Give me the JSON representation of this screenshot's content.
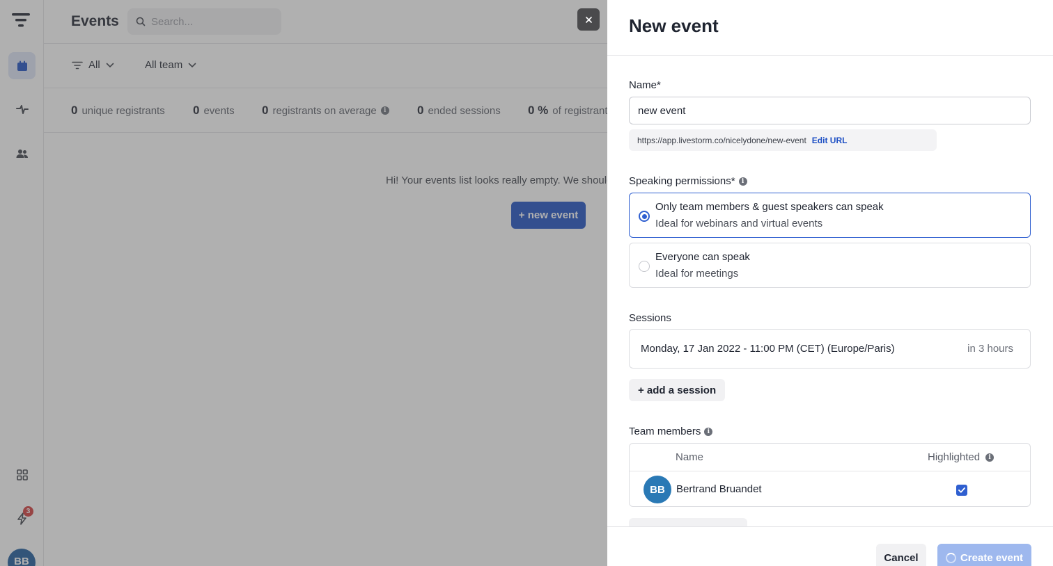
{
  "colors": {
    "accent": "#1d4fc4",
    "selected_border": "#2f5fd0",
    "badge": "#d23b3b",
    "overlay": "#505050"
  },
  "sidebar": {
    "items": [
      {
        "name": "calendar-icon",
        "active": true
      },
      {
        "name": "activity-icon",
        "active": false
      },
      {
        "name": "people-icon",
        "active": false
      },
      {
        "name": "apps-grid-icon",
        "active": false
      },
      {
        "name": "lightning-icon",
        "active": false
      }
    ],
    "notification_count": "3",
    "user_initials": "BB"
  },
  "header": {
    "title": "Events",
    "search_placeholder": "Search..."
  },
  "filters": {
    "status": "All",
    "team": "All team"
  },
  "stats": [
    {
      "value": "0",
      "label": "unique registrants"
    },
    {
      "value": "0",
      "label": "events"
    },
    {
      "value": "0",
      "label": "registrants on average"
    },
    {
      "value": "0",
      "label": "ended sessions"
    },
    {
      "value": "0 %",
      "label": "of registrant"
    }
  ],
  "empty_state": {
    "message": "Hi! Your events list looks really empty. We should",
    "button": "+ new event"
  },
  "drawer": {
    "title": "New event",
    "name_label": "Name*",
    "name_value": "new event",
    "url": "https://app.livestorm.co/nicelydone/new-event",
    "edit_url": "Edit URL",
    "permissions_label": "Speaking permissions*",
    "permissions": [
      {
        "title": "Only team members & guest speakers can speak",
        "subtitle": "Ideal for webinars and virtual events",
        "selected": true
      },
      {
        "title": "Everyone can speak",
        "subtitle": "Ideal for meetings",
        "selected": false
      }
    ],
    "sessions_label": "Sessions",
    "session": {
      "datetime": "Monday, 17 Jan 2022 - 11:00 PM (CET) (Europe/Paris)",
      "relative": "in 3 hours"
    },
    "add_session": "+ add a session",
    "team_label": "Team members",
    "team_columns": {
      "name": "Name",
      "highlighted": "Highlighted"
    },
    "members": [
      {
        "initials": "BB",
        "name": "Bertrand Bruandet",
        "highlighted": true
      }
    ],
    "cancel": "Cancel",
    "create": "Create event"
  }
}
